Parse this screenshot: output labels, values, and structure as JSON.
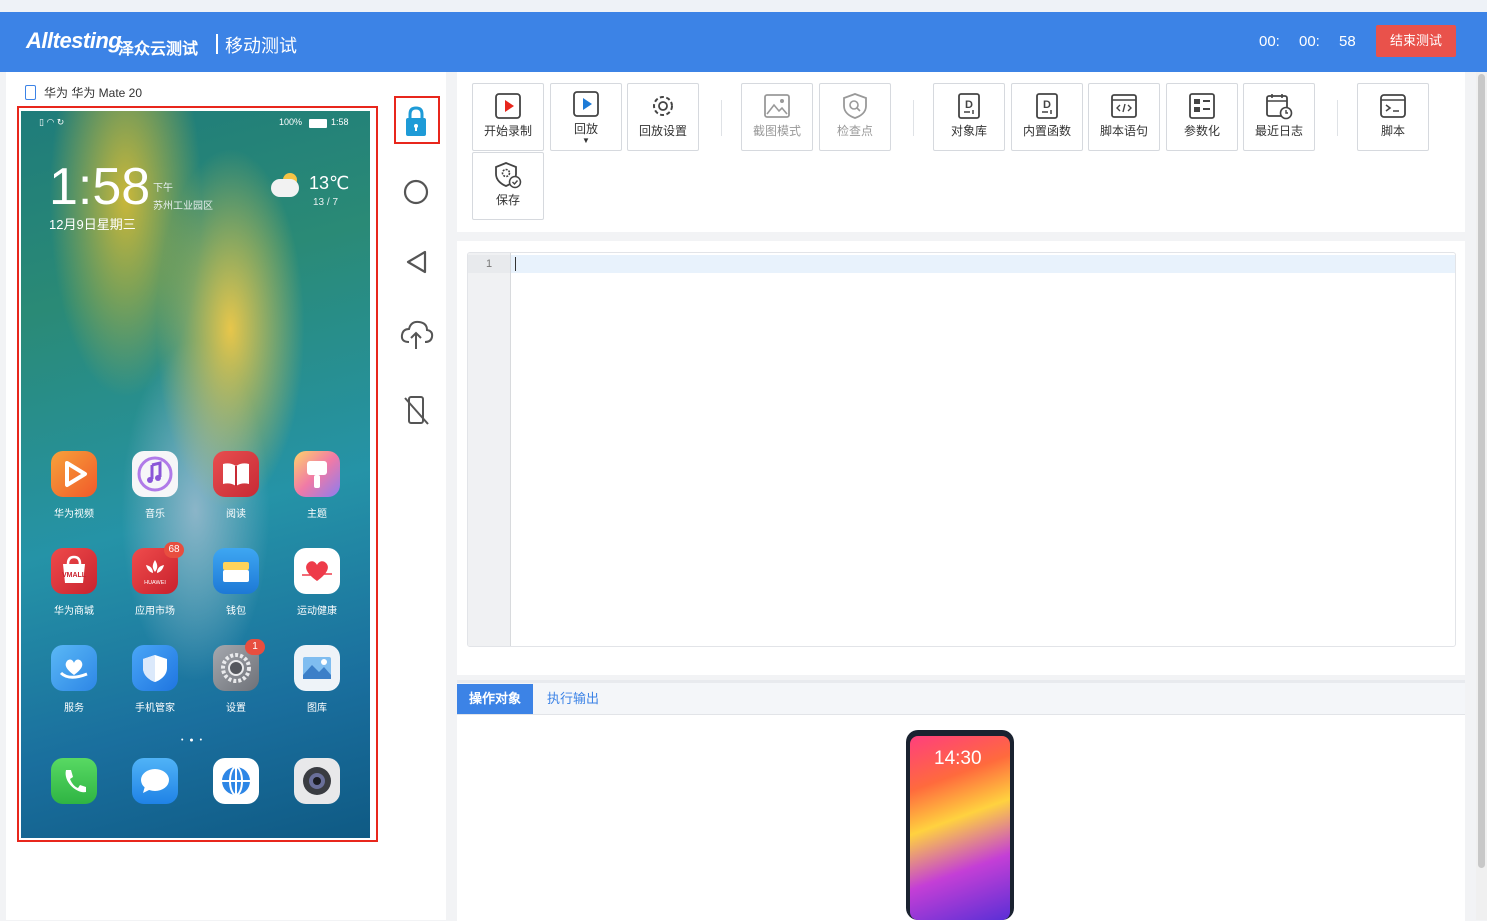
{
  "header": {
    "logo": "Alltesting",
    "brand_cn": "泽众云测试",
    "title": "移动测试",
    "timer": {
      "hours": "00:",
      "minutes": "00:",
      "seconds": "58"
    },
    "end_button": "结束测试"
  },
  "device": {
    "label": "华为 华为 Mate 20",
    "status_battery": "100%",
    "status_time": "1:58",
    "clock": "1:58",
    "ampm": "下午",
    "location": "苏州工业园区",
    "date": "12月9日星期三",
    "temperature": "13℃",
    "temp_range": "13 / 7",
    "apps": [
      {
        "label": "华为视频",
        "icon": "video-app-icon",
        "color": "#f26b2a"
      },
      {
        "label": "音乐",
        "icon": "music-app-icon",
        "color": "#f6f6f8"
      },
      {
        "label": "阅读",
        "icon": "reader-app-icon",
        "color": "#d93a3f"
      },
      {
        "label": "主题",
        "icon": "themes-app-icon",
        "color": "#f4a6c8"
      },
      {
        "label": "华为商城",
        "icon": "vmall-app-icon",
        "color": "#d9313a",
        "text": "VMALL"
      },
      {
        "label": "应用市场",
        "icon": "appgallery-app-icon",
        "color": "#d9313a",
        "badge": "68",
        "text": "HUAWEI"
      },
      {
        "label": "钱包",
        "icon": "wallet-app-icon",
        "color": "#2b8de0"
      },
      {
        "label": "运动健康",
        "icon": "health-app-icon",
        "color": "#ffffff"
      },
      {
        "label": "服务",
        "icon": "services-app-icon",
        "color": "#3aa0f0"
      },
      {
        "label": "手机管家",
        "icon": "phone-manager-app-icon",
        "color": "#2f90ef"
      },
      {
        "label": "设置",
        "icon": "settings-app-icon",
        "color": "#8a8d93",
        "badge": "1"
      },
      {
        "label": "图库",
        "icon": "gallery-app-icon",
        "color": "#eef3f8"
      }
    ],
    "dock": [
      {
        "icon": "phone-app-icon",
        "color": "#3ec74e"
      },
      {
        "icon": "messages-app-icon",
        "color": "#2f9af0"
      },
      {
        "icon": "browser-app-icon",
        "color": "#ffffff"
      },
      {
        "icon": "camera-app-icon",
        "color": "#e8e8ea"
      }
    ]
  },
  "side_tools": [
    {
      "icon": "lock-icon"
    },
    {
      "icon": "home-circle-icon"
    },
    {
      "icon": "back-triangle-icon"
    },
    {
      "icon": "upload-cloud-icon"
    },
    {
      "icon": "disconnect-phone-icon"
    }
  ],
  "toolbar": {
    "start_record": "开始录制",
    "playback": "回放",
    "playback_settings": "回放设置",
    "screenshot_mode": "截图模式",
    "checkpoint": "检查点",
    "object_library": "对象库",
    "builtin_functions": "内置函数",
    "script_statement": "脚本语句",
    "parameterize": "参数化",
    "recent_logs": "最近日志",
    "script": "脚本",
    "save": "保存"
  },
  "editor": {
    "line_number": "1"
  },
  "bottom_tabs": {
    "objects": "操作对象",
    "output": "执行输出"
  },
  "preview": {
    "time": "14:30"
  },
  "colors": {
    "primary": "#3c83e6",
    "danger": "#e9524b",
    "highlight_border": "#e8261c"
  }
}
